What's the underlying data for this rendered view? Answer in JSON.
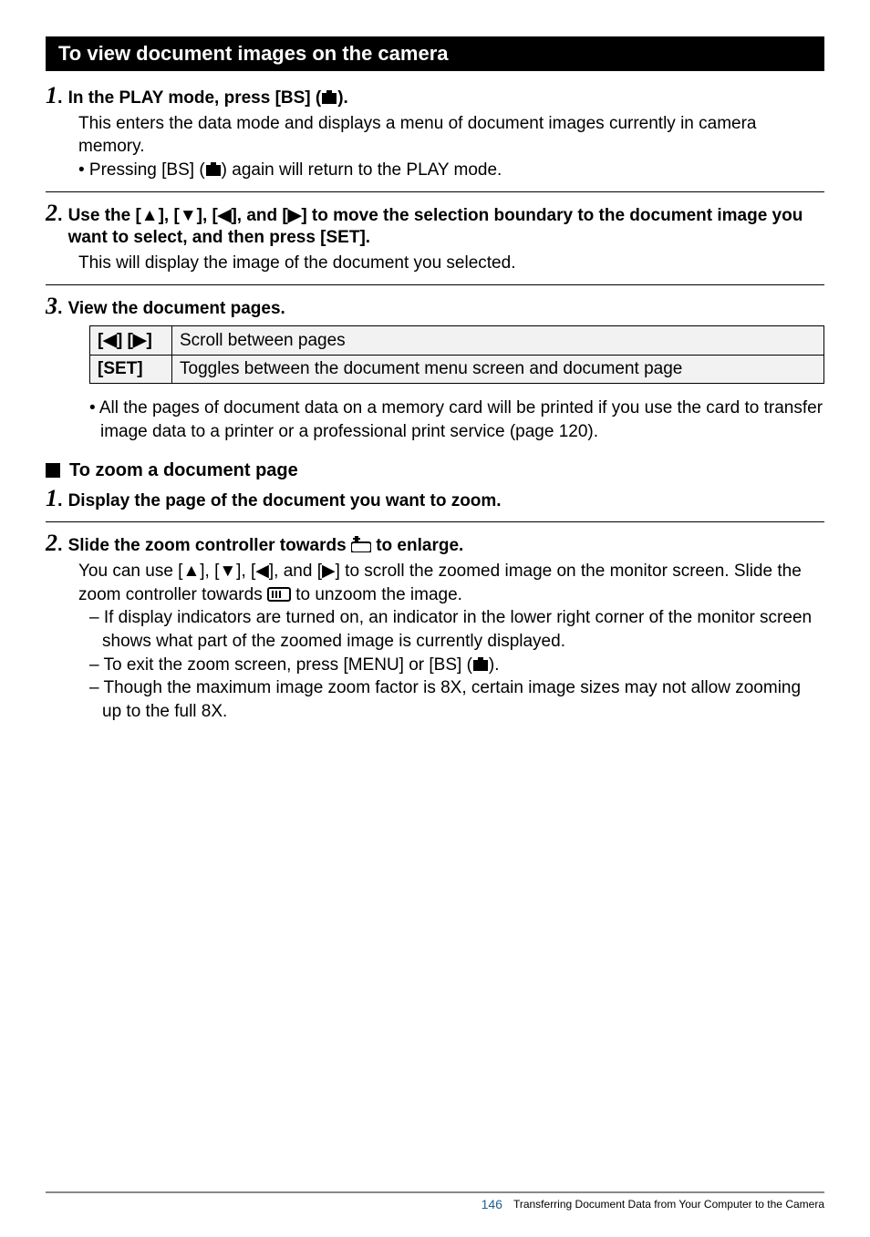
{
  "sectionHeader": "To view document images on the camera",
  "step1": {
    "titlePrefix": "In the PLAY mode, press [BS] (",
    "titleSuffix": ").",
    "body": "This enters the data mode and displays a menu of document images currently in camera memory.",
    "bulletPrefix": "• Pressing [BS] (",
    "bulletSuffix": ") again will return to the PLAY mode."
  },
  "step2": {
    "title": "Use the [▲], [▼], [◀], and [▶] to move the selection boundary to the document image you want to select, and then press [SET].",
    "body": "This will display the image of the document you selected."
  },
  "step3": {
    "title": "View the document pages.",
    "table": {
      "row1key": "[◀] [▶]",
      "row1val": "Scroll between pages",
      "row2key": "[SET]",
      "row2val": "Toggles between the document menu screen and document page"
    },
    "bullet": "• All the pages of document data on a memory card will be printed if you use the card to transfer image data to a printer or a professional print service (page 120)."
  },
  "subHeading": "To zoom a document page",
  "zstep1": {
    "title": "Display the page of the document you want to zoom."
  },
  "zstep2": {
    "titlePrefix": "Slide the zoom controller towards ",
    "titleSuffix": " to enlarge.",
    "bodyPrefix": "You can use [▲], [▼], [◀], and [▶] to scroll the zoomed image on the monitor screen. Slide the zoom controller towards ",
    "bodySuffix": " to unzoom the image.",
    "dash1": "– If display indicators are turned on, an indicator in the lower right corner of the monitor screen shows what part of the zoomed image is currently displayed.",
    "dash2Prefix": "– To exit the zoom screen, press [MENU] or [BS] (",
    "dash2Suffix": ").",
    "dash3": "– Though the maximum image zoom factor is 8X, certain image sizes may not allow zooming up to the full 8X."
  },
  "footer": {
    "page": "146",
    "text": "Transferring Document Data from Your Computer to the Camera"
  }
}
